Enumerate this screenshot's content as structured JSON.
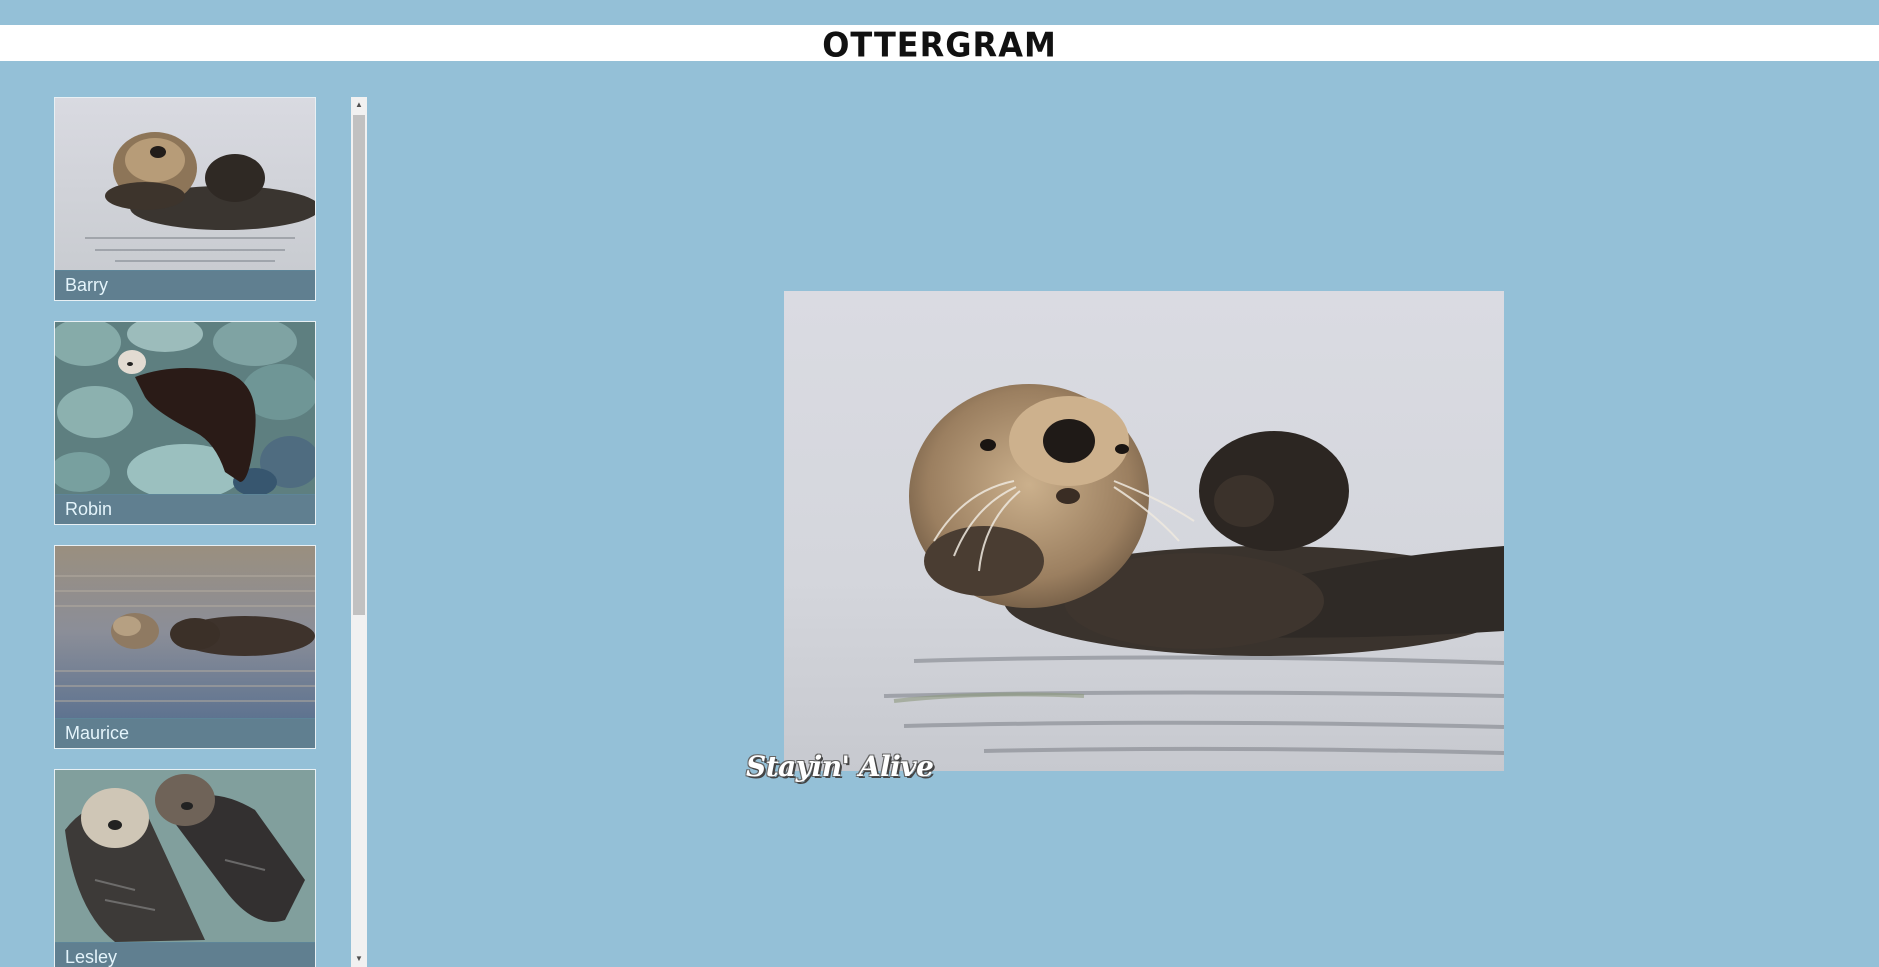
{
  "header": {
    "logo_text": "OTTERGRAM"
  },
  "thumbnails": [
    {
      "label": "Barry",
      "image": "otter-floating-with-pup"
    },
    {
      "label": "Robin",
      "image": "otter-on-rocks"
    },
    {
      "label": "Maurice",
      "image": "otter-floating-in-water"
    },
    {
      "label": "Lesley",
      "image": "otters-holding-paws"
    }
  ],
  "detail": {
    "title": "Stayin' Alive",
    "image": "otter-floating-with-pup"
  },
  "colors": {
    "background": "#94c0d7",
    "header": "#ffffff",
    "caption_bg": "#607f90",
    "caption_text": "#e4f4fb"
  }
}
